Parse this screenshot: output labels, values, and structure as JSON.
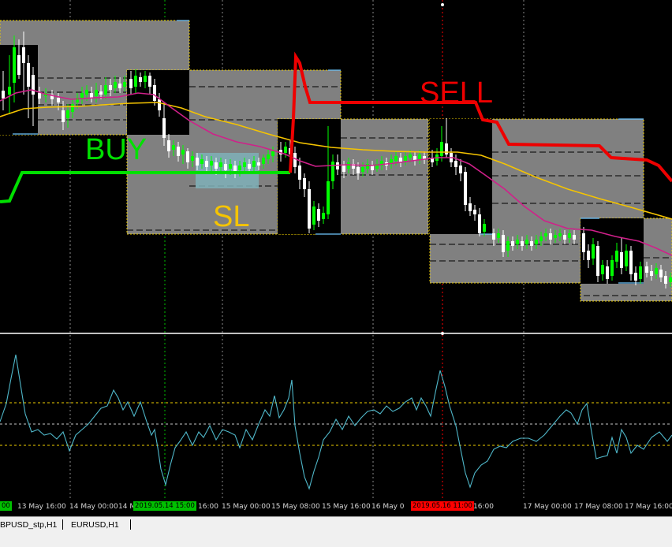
{
  "annotations": {
    "buy": "BUY",
    "sell": "SELL",
    "sl": "SL"
  },
  "colors": {
    "background": "#000000",
    "grid": "#8a8a8a",
    "candle_up": "#00ff00",
    "candle_down": "#ffffff",
    "box_fill": "#808080",
    "box_border": "#f0d000",
    "ma_fast": "#d0208a",
    "ma_slow": "#f5c400",
    "buy_line": "#00e000",
    "sell_line": "#ee0000",
    "sl_zone": "#7fb0b8",
    "oscillator": "#4fb7c9",
    "sl_text": "#f5c400",
    "marker_green": "#00c000",
    "marker_red": "#ff0000"
  },
  "time_axis": {
    "labels": [
      "13 May 16:00",
      "14 May 00:00",
      "14 M",
      "16:00",
      "15 May 00:00",
      "15 May 08:00",
      "15 May 16:00",
      "16 May 0",
      "16:00",
      "17 May 00:00",
      "17 May 08:00",
      "17 May 16:00"
    ],
    "edge_label": "00",
    "green_tag": "2019.05.14 15:00",
    "red_tag": "2019.05.16 11:00"
  },
  "tabs": [
    "BPUSD_stp,H1",
    "EURUSD,H1"
  ]
}
